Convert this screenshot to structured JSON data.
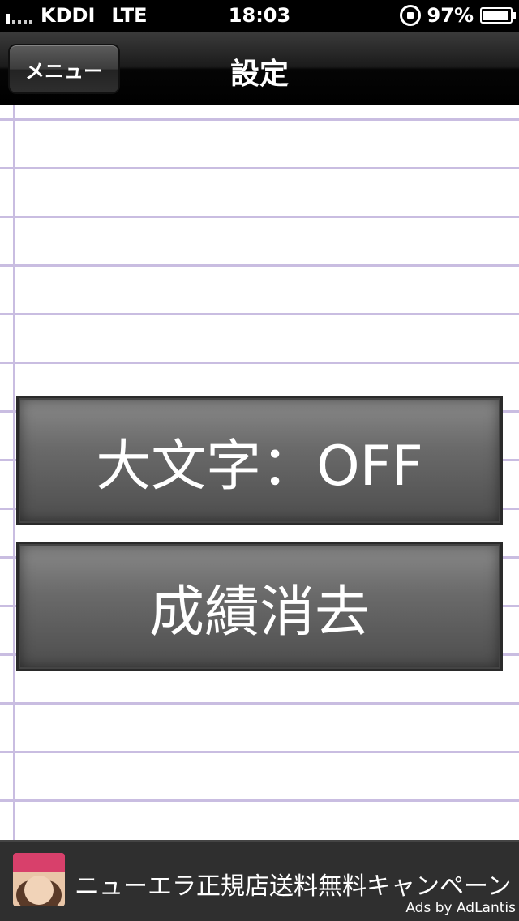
{
  "status_bar": {
    "carrier": "KDDI",
    "network": "LTE",
    "time": "18:03",
    "battery": "97%",
    "icons": [
      "signal-icon",
      "rotation-lock-icon",
      "battery-icon"
    ]
  },
  "nav": {
    "title": "設定",
    "menu_label": "メニュー"
  },
  "buttons": {
    "large_text_label": "大文字：OFF",
    "clear_scores_label": "成績消去"
  },
  "ad": {
    "text": "ニューエラ正規店送料無料キャンペーン",
    "credit": "Ads by AdLantis"
  },
  "colors": {
    "paper_lines": "#c9bde1",
    "nav_bar": "#000000",
    "button_gray": "#6a6a6a"
  }
}
